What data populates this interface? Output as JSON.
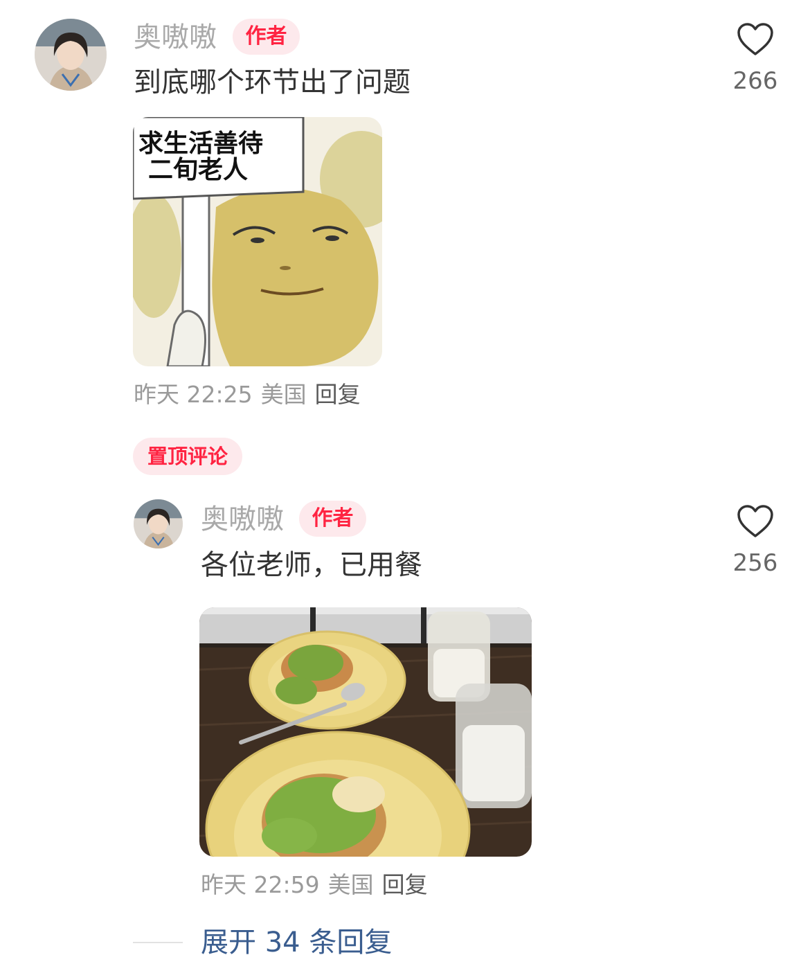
{
  "comment1": {
    "username": "奥嗷嗷",
    "badge": "作者",
    "text": "到底哪个环节出了问题",
    "likes": "266",
    "image_caption_line1": "求生活善待",
    "image_caption_line2": "二旬老人",
    "time": "昨天 22:25",
    "location": "美国",
    "reply": "回复"
  },
  "pinned_label": "置顶评论",
  "comment2": {
    "username": "奥嗷嗷",
    "badge": "作者",
    "text": "各位老师，已用餐",
    "likes": "256",
    "time": "昨天 22:59",
    "location": "美国",
    "reply": "回复"
  },
  "expand_replies": "展开 34 条回复",
  "colors": {
    "accent": "#ff2442",
    "badge_bg": "#fde9ec",
    "link": "#3a5d8f"
  },
  "icons": [
    "heart-outline-icon",
    "avatar-photo"
  ]
}
